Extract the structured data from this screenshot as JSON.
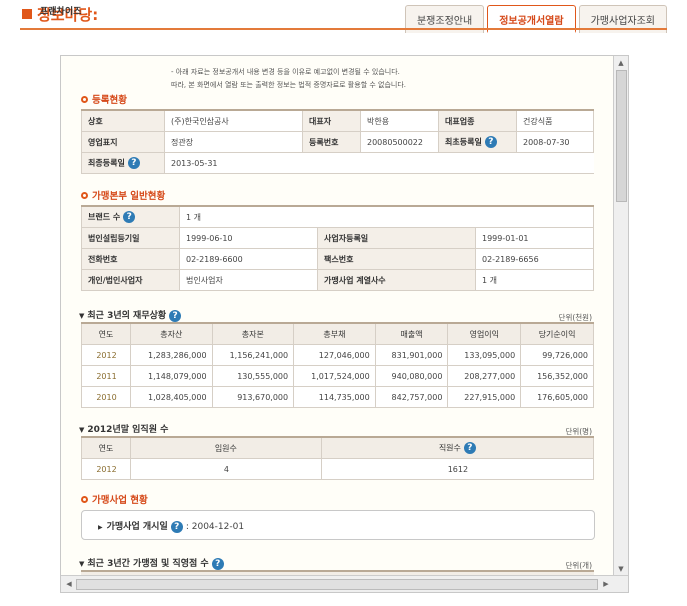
{
  "header": {
    "title": "정보마당",
    "separator": ":",
    "subtitle": "프랜차이즈",
    "tabs": [
      {
        "label": "분쟁조정안내",
        "active": false
      },
      {
        "label": "정보공개서열람",
        "active": true
      },
      {
        "label": "가맹사업자조회",
        "active": false
      }
    ]
  },
  "notice": {
    "line1": "- 아래 자료는 정보공개서 내용 변경 등을 이유로 예고없이 변경될 수 있습니다.",
    "line2": "따라, 본 화면에서 열람 또는 출력한 정보는 법적 증명자료로 활용할 수 없습니다."
  },
  "registration": {
    "heading": "등록현황",
    "labels": {
      "company": "상호",
      "ceo": "대표자",
      "industry": "대표업종",
      "brand": "영업표지",
      "reg_no": "등록번호",
      "first_reg": "최초등록일",
      "last_reg": "최종등록일"
    },
    "values": {
      "company": "(주)한국인삼공사",
      "ceo": "박한용",
      "industry": "건강식품",
      "brand": "정관장",
      "reg_no": "20080500022",
      "first_reg": "2008-07-30",
      "last_reg": "2013-05-31"
    }
  },
  "hq": {
    "heading": "가맹본부 일반현황",
    "labels": {
      "brand_count": "브랜드 수",
      "corp_date": "법인설립등기일",
      "biz_reg_date": "사업자등록일",
      "phone": "전화번호",
      "fax": "팩스번호",
      "type": "개인/법인사업자",
      "affiliates": "가맹사업 계열사수"
    },
    "values": {
      "brand_count": "1 개",
      "corp_date": "1999-06-10",
      "biz_reg_date": "1999-01-01",
      "phone": "02-2189-6600",
      "fax": "02-2189-6656",
      "type": "법인사업자",
      "affiliates": "1 개"
    }
  },
  "finance": {
    "heading": "최근 3년의 재무상황",
    "unit": "단위(천원)",
    "columns": [
      "연도",
      "총자산",
      "총자본",
      "총부채",
      "매출액",
      "영업이익",
      "당기순이익"
    ],
    "rows": [
      [
        "2012",
        "1,283,286,000",
        "1,156,241,000",
        "127,046,000",
        "831,901,000",
        "133,095,000",
        "99,726,000"
      ],
      [
        "2011",
        "1,148,079,000",
        "130,555,000",
        "1,017,524,000",
        "940,080,000",
        "208,277,000",
        "156,352,000"
      ],
      [
        "2010",
        "1,028,405,000",
        "913,670,000",
        "114,735,000",
        "842,757,000",
        "227,915,000",
        "176,605,000"
      ]
    ]
  },
  "staff": {
    "heading": "2012년말 임직원 수",
    "unit": "단위(명)",
    "columns": [
      "연도",
      "임원수",
      "직원수"
    ],
    "row": [
      "2012",
      "4",
      "1612"
    ]
  },
  "business": {
    "heading": "가맹사업 현황",
    "start_label": "가맹사업 개시일",
    "start_value": ": 2004-12-01"
  },
  "stores": {
    "heading": "최근 3년간 가맹점 및 직영점 수",
    "unit": "단위(개)"
  },
  "icons": {
    "help": "?",
    "help_icon_color": "#2e7bb5",
    "accent": "#e0571a"
  }
}
